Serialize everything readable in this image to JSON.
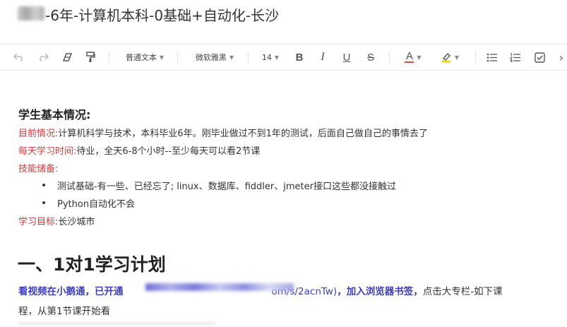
{
  "document": {
    "title": "-6年-计算机本科-0基础+自动化-长沙"
  },
  "toolbar": {
    "paragraph_style": "普通文本",
    "font_family": "微软雅黑",
    "font_size": "14",
    "bold": "B",
    "italic": "I",
    "underline": "U",
    "strikethrough": "S",
    "font_color": "A",
    "more": "›"
  },
  "content": {
    "heading_basic": "学生基本情况:",
    "current_label": "目前情况:",
    "current_text": "计算机科学与技术，本科毕业6年。刚毕业做过不到1年的测试，后面自己做自己的事情去了",
    "daily_label": "每天学习时间:",
    "daily_text": "待业，全天6-8个小时--至少每天可以看2节课",
    "skills_label": "技能储备:",
    "skills": [
      "测试基础-有一些、已经忘了; linux、数据库、fiddler、jmeter接口这些都没接触过",
      "Python自动化不会"
    ],
    "goal_label": "学习目标:",
    "goal_text": "长沙城市",
    "plan_heading": "一、1对1学习计划",
    "plan_line1_a": "看视频在小鹅通，已开通",
    "plan_line1_link": "om/s/2acnTw)",
    "plan_line1_b": "，加入浏览器书签，",
    "plan_line1_c": "点击大专栏-如下课",
    "plan_line2": "程，从第1节课开始看"
  },
  "colors": {
    "label_red": "#d23c3c",
    "link_blue": "#3b3bc4",
    "font_color_underline": "#e04a3c",
    "highlight_yellow": "#f5d300"
  },
  "icons": [
    "undo-icon",
    "redo-icon",
    "eraser-icon",
    "format-painter-icon",
    "highlight-icon",
    "bulleted-list-icon",
    "numbered-list-icon",
    "checkbox-icon"
  ]
}
